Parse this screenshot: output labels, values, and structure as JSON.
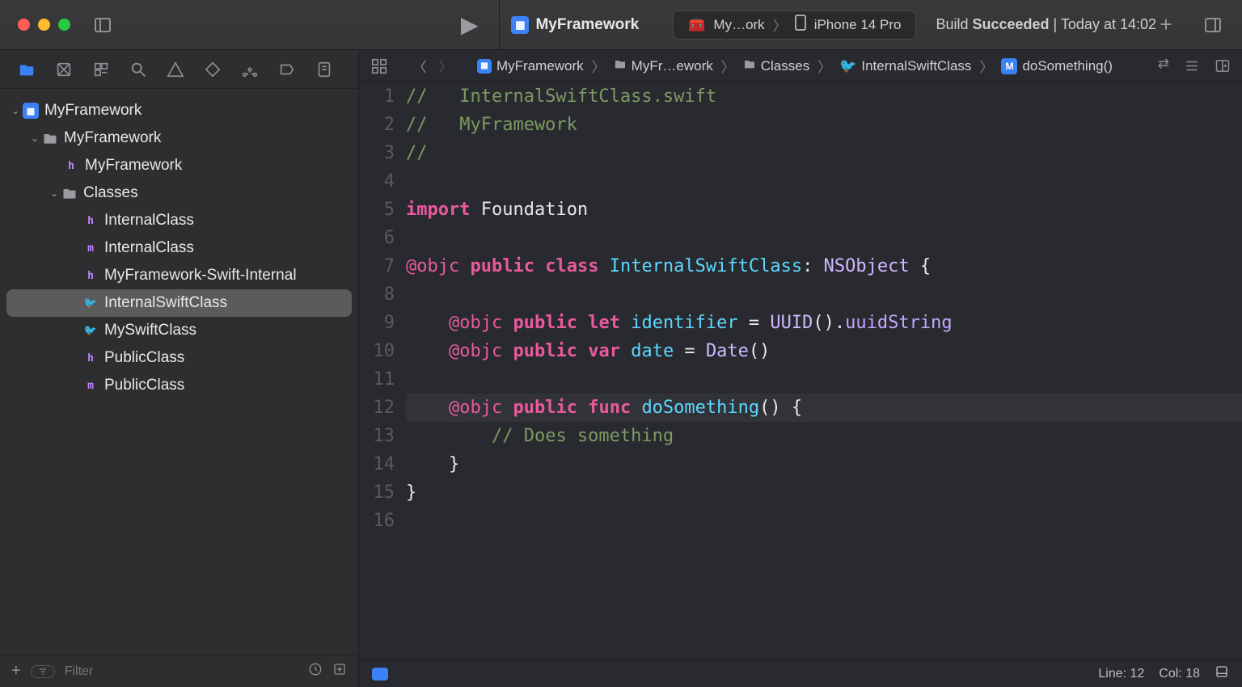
{
  "toolbar": {
    "project_title": "MyFramework",
    "scheme": "My…ork",
    "destination": "iPhone 14 Pro",
    "status_prefix": "Build",
    "status_strong": "Succeeded",
    "status_time": "Today at 14:02"
  },
  "sidebar": {
    "filter_placeholder": "Filter",
    "tree": {
      "root": "MyFramework",
      "group1": "MyFramework",
      "header1": "MyFramework",
      "classes": "Classes",
      "items": [
        {
          "name": "InternalClass",
          "type": "h"
        },
        {
          "name": "InternalClass",
          "type": "m"
        },
        {
          "name": "MyFramework-Swift-Internal",
          "type": "h"
        },
        {
          "name": "InternalSwiftClass",
          "type": "swift",
          "selected": true
        },
        {
          "name": "MySwiftClass",
          "type": "swift"
        },
        {
          "name": "PublicClass",
          "type": "h"
        },
        {
          "name": "PublicClass",
          "type": "m"
        }
      ]
    }
  },
  "jumpbar": {
    "seg1": "MyFramework",
    "seg2": "MyFr…ework",
    "seg3": "Classes",
    "seg4": "InternalSwiftClass",
    "seg5": "doSomething()"
  },
  "code": {
    "lines": 16,
    "c1a": "//   InternalSwiftClass.swift",
    "c2a": "//   MyFramework",
    "c3a": "//",
    "import_kw": "import",
    "import_mod": "Foundation",
    "objc": "@objc",
    "public": "public",
    "class": "class",
    "let": "let",
    "var": "var",
    "func_kw": "func",
    "classname": "InternalSwiftClass",
    "nsobject": "NSObject",
    "identifier": "identifier",
    "uuid": "UUID",
    "uuidString": "uuidString",
    "date_ident": "date",
    "date_type": "Date",
    "dosomething": "doSomething",
    "does_comment": "// Does something"
  },
  "statusbar": {
    "line": "Line: 12",
    "col": "Col: 18"
  }
}
